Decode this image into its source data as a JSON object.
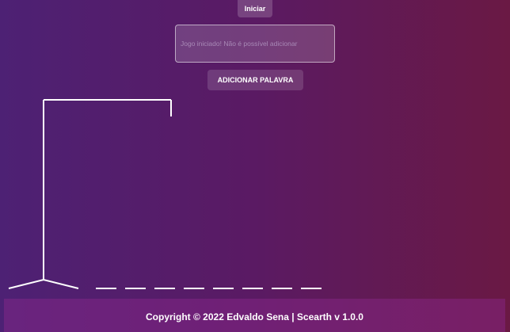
{
  "controls": {
    "start_label": "Iniciar",
    "input_placeholder": "Jogo iniciado! Não é possível adicionar",
    "input_value": "",
    "add_word_label": "ADICIONAR PALAVRA"
  },
  "game": {
    "hidden_letter_slots": 8
  },
  "footer": {
    "copyright": "Copyright © 2022 Edvaldo Sena | Scearth v 1.0.0"
  },
  "colors": {
    "gradient_left": "#4d2174",
    "gradient_right": "#6a1944",
    "line": "#ffffff"
  }
}
